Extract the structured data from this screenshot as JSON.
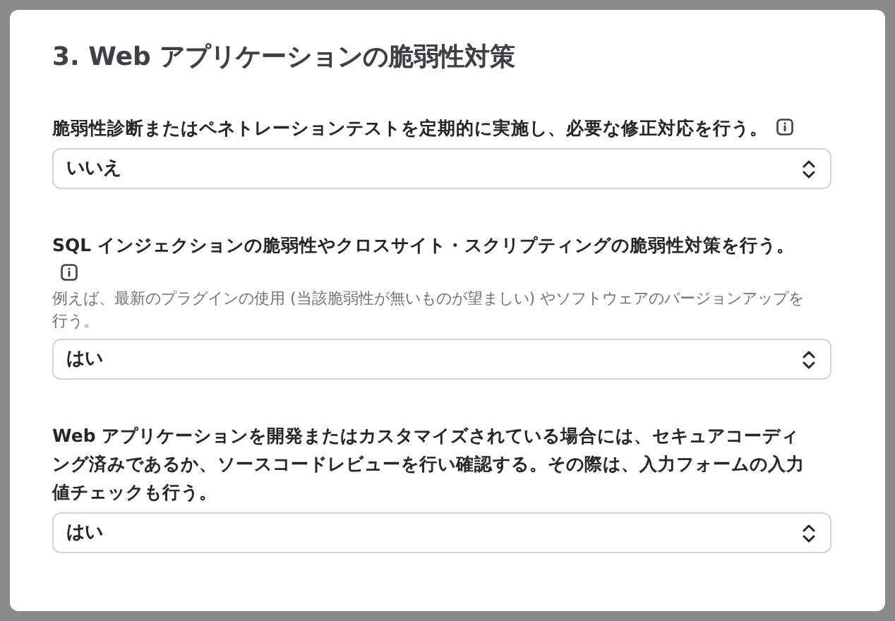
{
  "heading": "3. Web アプリケーションの脆弱性対策",
  "questions": [
    {
      "label": "脆弱性診断またはペネトレーションテストを定期的に実施し、必要な修正対応を行う。",
      "info": true,
      "value": "いいえ"
    },
    {
      "label": "SQL インジェクションの脆弱性やクロスサイト・スクリプティングの脆弱性対策を行う。",
      "info": true,
      "hint": "例えば、最新のプラグインの使用 (当該脆弱性が無いものが望ましい) やソフトウェアのバージョンアップを行う。",
      "value": "はい"
    },
    {
      "label": "Web アプリケーションを開発またはカスタマイズされている場合には、セキュアコーディング済みであるか、ソースコードレビューを行い確認する。その際は、入力フォームの入力値チェックも行う。",
      "info": false,
      "value": "はい"
    }
  ]
}
